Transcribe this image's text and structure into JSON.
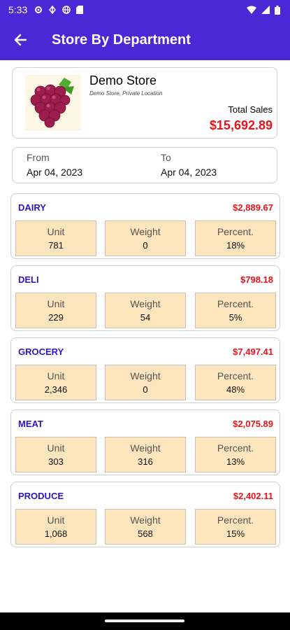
{
  "status": {
    "time": "5:33"
  },
  "app_bar": {
    "title": "Store By Department"
  },
  "store": {
    "name": "Demo Store",
    "subtitle": "Demo Store, Private Location",
    "total_label": "Total Sales",
    "total_value": "$15,692.89"
  },
  "dates": {
    "from_label": "From",
    "from_value": "Apr 04, 2023",
    "to_label": "To",
    "to_value": "Apr 04, 2023"
  },
  "stat_labels": {
    "unit": "Unit",
    "weight": "Weight",
    "percent": "Percent."
  },
  "departments": [
    {
      "name": "DAIRY",
      "total": "$2,889.67",
      "unit": "781",
      "weight": "0",
      "percent": "18%"
    },
    {
      "name": "DELI",
      "total": "$798.18",
      "unit": "229",
      "weight": "54",
      "percent": "5%"
    },
    {
      "name": "GROCERY",
      "total": "$7,497.41",
      "unit": "2,346",
      "weight": "0",
      "percent": "48%"
    },
    {
      "name": "MEAT",
      "total": "$2,075.89",
      "unit": "303",
      "weight": "316",
      "percent": "13%"
    },
    {
      "name": "PRODUCE",
      "total": "$2,402.11",
      "unit": "1,068",
      "weight": "568",
      "percent": "15%"
    }
  ],
  "colors": {
    "app_bar": "#4a28d6",
    "dept_name": "#2b16c7",
    "money": "#e8141c",
    "stat_box": "#fce4bd"
  },
  "icons": {
    "back": "arrow-back-icon",
    "store_logo": "grapes-icon"
  }
}
